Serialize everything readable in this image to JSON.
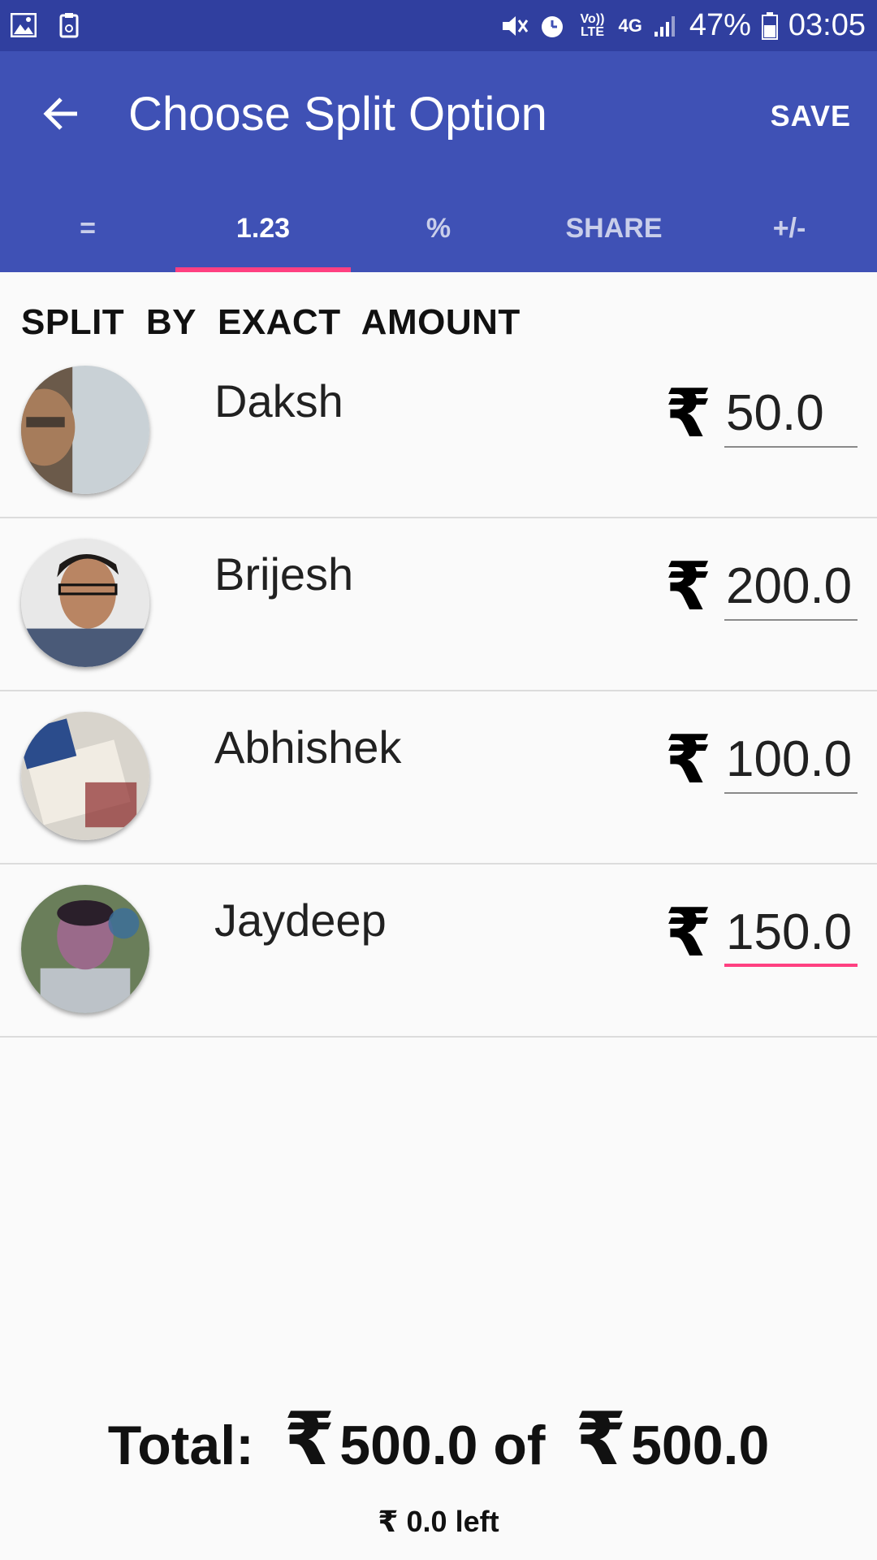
{
  "status_bar": {
    "volte": "Vo)) LTE",
    "network": "4G",
    "battery": "47%",
    "time": "03:05"
  },
  "app_bar": {
    "title": "Choose Split Option",
    "save_label": "SAVE"
  },
  "tabs": [
    {
      "label": "="
    },
    {
      "label": "1.23"
    },
    {
      "label": "%"
    },
    {
      "label": "SHARE"
    },
    {
      "label": "+/-"
    }
  ],
  "active_tab": 1,
  "section_title": "SPLIT BY EXACT AMOUNT",
  "currency_symbol": "₹",
  "members": [
    {
      "name": "Daksh",
      "amount": "50.0"
    },
    {
      "name": "Brijesh",
      "amount": "200.0"
    },
    {
      "name": "Abhishek",
      "amount": "100.0"
    },
    {
      "name": "Jaydeep",
      "amount": "150.0"
    }
  ],
  "footer": {
    "total_label": "Total:",
    "total_amount": "500.0",
    "of_label": "of",
    "target_amount": "500.0",
    "left_amount": "0.0",
    "left_label": "left"
  },
  "colors": {
    "primary": "#3f51b5",
    "primary_dark": "#303f9f",
    "accent": "#ff4081"
  },
  "icons": {
    "back": "arrow-back-icon",
    "gallery": "image-icon",
    "clipboard": "clipboard-icon",
    "mute": "vibrate-mute-icon",
    "alarm": "alarm-icon",
    "signal": "signal-icon",
    "battery": "battery-icon"
  }
}
